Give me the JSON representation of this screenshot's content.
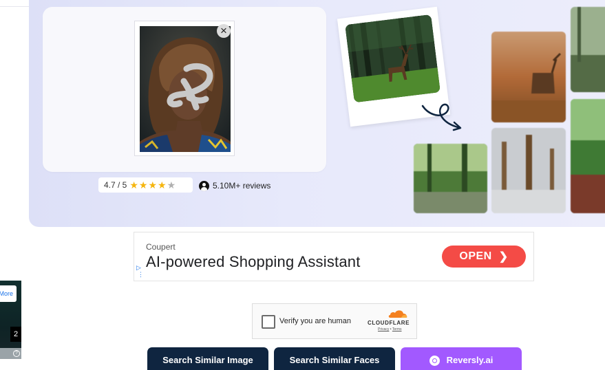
{
  "colors": {
    "hero_background": "#e7e9fb",
    "dark_button": "#0f2540",
    "accent_purple": "#a259ff",
    "ad_open_button": "#f44b46",
    "star": "#f5b50e"
  },
  "upload": {
    "close_icon": "×"
  },
  "rating": {
    "score": "4.7 / 5",
    "stars_value": 4.7,
    "stars": "★★★★",
    "half_star": "★",
    "reviews": "5.10M+ reviews"
  },
  "ad": {
    "brand": "Coupert",
    "headline": "AI-powered Shopping Assistant",
    "cta": "OPEN",
    "cta_icon": "chevron-right-icon",
    "adchoices_icon": "▷",
    "dots_icon": "⋮"
  },
  "captcha": {
    "label": "Verify you are human",
    "provider": "CLOUDFLARE",
    "privacy": "Privacy",
    "separator": "•",
    "terms": "Terms"
  },
  "buttons": {
    "search_image": "Search Similar Image",
    "search_faces": "Search Similar Faces",
    "reversly": "Reversly.ai"
  },
  "left_widget": {
    "more_label": "More",
    "count": "2",
    "help": "?"
  }
}
